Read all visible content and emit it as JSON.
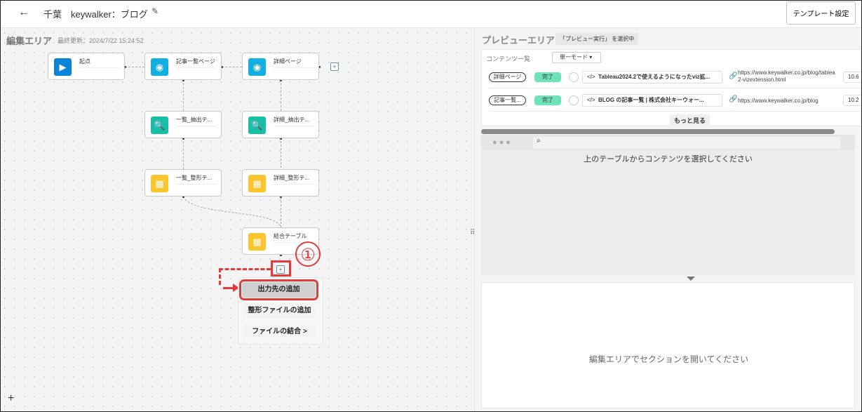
{
  "header": {
    "title": "千葉　keywalker：ブログ",
    "template_button": "テンプレート設定"
  },
  "edit": {
    "title": "編集エリア",
    "last_updated": "最終更新：2024/7/22 15:24:52",
    "nodes": [
      {
        "label": "起点"
      },
      {
        "label": "記事一覧ページ"
      },
      {
        "label": "詳細ページ"
      },
      {
        "label": "一覧_抽出テ..."
      },
      {
        "label": "詳細_抽出テ..."
      },
      {
        "label": "一覧_整形テ..."
      },
      {
        "label": "詳細_整形テ..."
      },
      {
        "label": "結合テーブル"
      }
    ],
    "plus": "+",
    "menu": [
      "出力先の追加",
      "整形ファイルの追加",
      "ファイルの結合 >"
    ],
    "annotation": "①"
  },
  "preview": {
    "title": "プレビューエリア",
    "status": "「プレビュー実行」 を選択中",
    "list_label": "コンテンツ一覧",
    "mode": "単一モード",
    "rows": [
      {
        "tag": "詳細ページ",
        "status": "完了",
        "title": "Tableau2024.2で使えるようになったviz拡...",
        "url1": "https://www.keywalker.co.jp/blog/tablea",
        "url2": "2-vizextension.html",
        "num": "10.6"
      },
      {
        "tag": "記事一覧...",
        "status": "完了",
        "title": "BLOG の記事一覧 | 株式会社キーウォー...",
        "url1": "https://www.keywalker.co.jp/blog",
        "url2": "",
        "num": "10.2"
      }
    ],
    "more": "もっと見る",
    "browser_msg": "上のテーブルからコンテンツを選択してください",
    "section_msg": "編集エリアでセクションを開いてください"
  },
  "colors": {
    "start": "#0a84d6",
    "page": "#13afe0",
    "extract": "#16bfa5",
    "table": "#fbc62d",
    "annotation": "#e03c3c",
    "done": "#6ee3b7"
  }
}
